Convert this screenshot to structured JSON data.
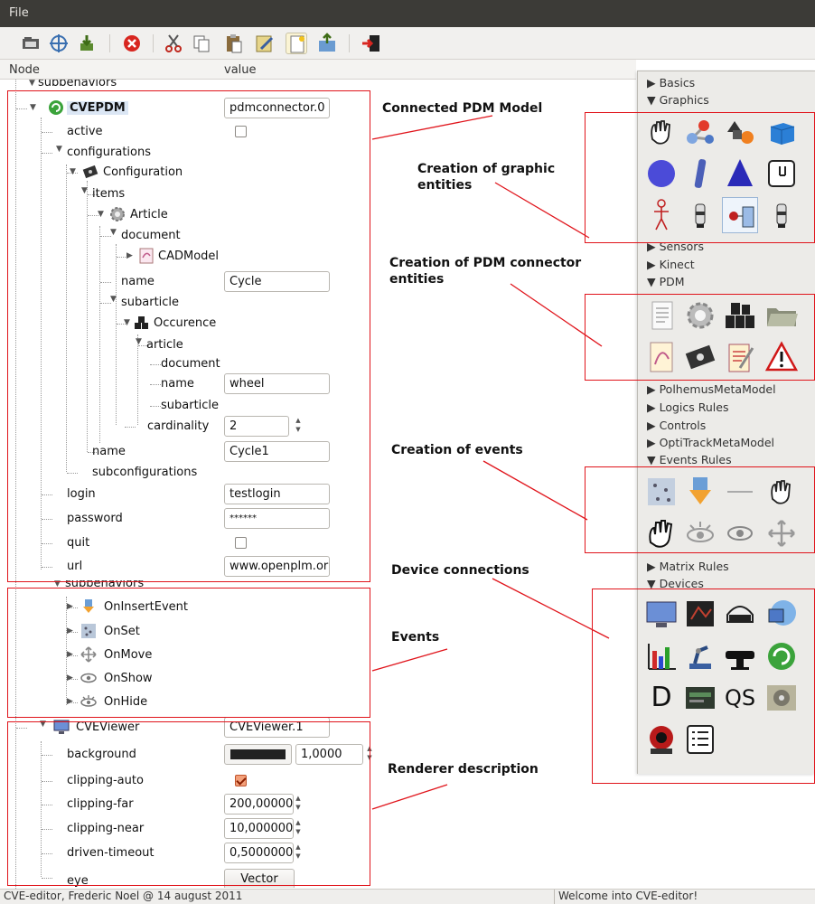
{
  "menubar": {
    "file": "File"
  },
  "toolbar": {
    "buttons": [
      "open-icon",
      "network-icon",
      "save-icon",
      "stop-icon",
      "cut-icon",
      "copy-icon",
      "paste-icon",
      "edit-icon",
      "new-icon",
      "export-icon",
      "exit-icon"
    ]
  },
  "tree": {
    "columns": {
      "node": "Node",
      "value": "value"
    },
    "rows": {
      "subbehaviors_top": "subbehaviors",
      "cvepdm": "CVEPDM",
      "cvepdm_value": "pdmconnector.0",
      "active": "active",
      "configurations": "configurations",
      "configuration": "Configuration",
      "items": "items",
      "article": "Article",
      "document": "document",
      "cadmodel": "CADModel",
      "name1": "name",
      "name1_value": "Cycle",
      "subarticle": "subarticle",
      "occurence": "Occurence",
      "article2": "article",
      "document2": "document",
      "name2": "name",
      "name2_value": "wheel",
      "subarticle2": "subarticle",
      "cardinality": "cardinality",
      "cardinality_value": "2",
      "name3": "name",
      "name3_value": "Cycle1",
      "subconfigurations": "subconfigurations",
      "login": "login",
      "login_value": "testlogin",
      "password": "password",
      "password_value": "******",
      "quit": "quit",
      "url": "url",
      "url_value": "www.openplm.or",
      "subbehaviors": "subbehaviors",
      "oninsertevent": "OnInsertEvent",
      "onset": "OnSet",
      "onmove": "OnMove",
      "onshow": "OnShow",
      "onhide": "OnHide",
      "cveviewer": "CVEViewer",
      "cveviewer_value": "CVEViewer.1",
      "background": "background",
      "background_value": "1,0000",
      "clipping_auto": "clipping-auto",
      "clipping_far": "clipping-far",
      "clipping_far_value": "200,000000",
      "clipping_near": "clipping-near",
      "clipping_near_value": "10,0000000",
      "driven_timeout": "driven-timeout",
      "driven_timeout_value": "0,50000000",
      "eye": "eye",
      "eye_value": "Vector"
    }
  },
  "annotations": {
    "connected_pdm": "Connected PDM Model",
    "graphic_entities_1": "Creation of graphic",
    "graphic_entities_2": "entities",
    "pdm_connector_1": "Creation of PDM connector",
    "pdm_connector_2": "entities",
    "events_creation": "Creation of events",
    "device_connections": "Device connections",
    "events": "Events",
    "renderer": "Renderer description"
  },
  "palette": {
    "categories": {
      "basics": "Basics",
      "graphics": "Graphics",
      "sensors": "Sensors",
      "kinect": "Kinect",
      "pdm": "PDM",
      "polhemus": "PolhemusMetaModel",
      "logics": "Logics Rules",
      "controls": "Controls",
      "optitrack": "OptiTrackMetaModel",
      "events_rules": "Events Rules",
      "matrix": "Matrix Rules",
      "devices": "Devices"
    },
    "device_text_icons": {
      "d": "D",
      "qs": "QS"
    }
  },
  "status": {
    "left": "CVE-editor, Frederic Noel @ 14 august 2011",
    "right": "Welcome into CVE-editor!"
  },
  "colors": {
    "menubar": "#3c3b37",
    "annotation_red": "#e0141b",
    "background_swatch": "#222222"
  }
}
